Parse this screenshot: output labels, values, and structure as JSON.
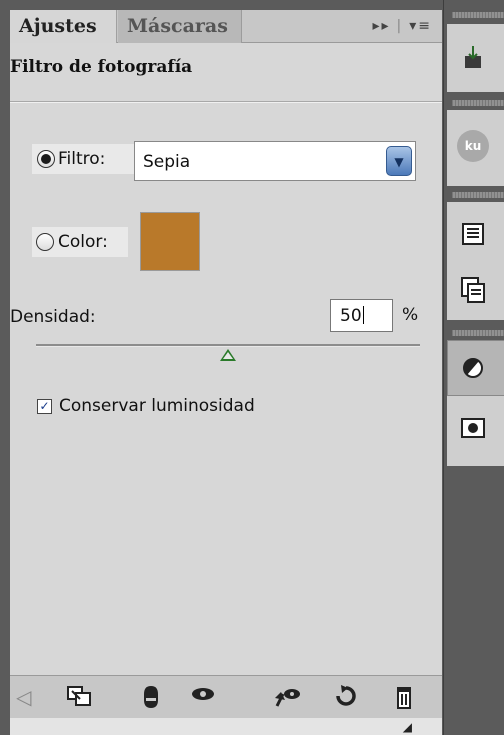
{
  "tabs": {
    "adjustments": "Ajustes",
    "masks": "Máscaras"
  },
  "panel_menu": {
    "expand": "▸▸",
    "menu": "▾≡"
  },
  "title": "Filtro de fotografía",
  "filter": {
    "label": "Filtro:",
    "selected": "Sepia",
    "checked": true
  },
  "color": {
    "label": "Color:",
    "checked": false,
    "swatch": "#b9792a"
  },
  "density": {
    "label": "Densidad:",
    "value": "50",
    "unit": "%",
    "slider_fraction": 0.5
  },
  "preserve": {
    "label": "Conservar luminosidad",
    "checked": true
  },
  "bottom_icons": [
    "back-arrow-icon",
    "expand-view-icon",
    "clip-layer-icon",
    "visibility-eye-icon",
    "view-previous-state-icon",
    "reset-icon",
    "trash-icon"
  ],
  "dock": {
    "ku_badge": "ku"
  }
}
